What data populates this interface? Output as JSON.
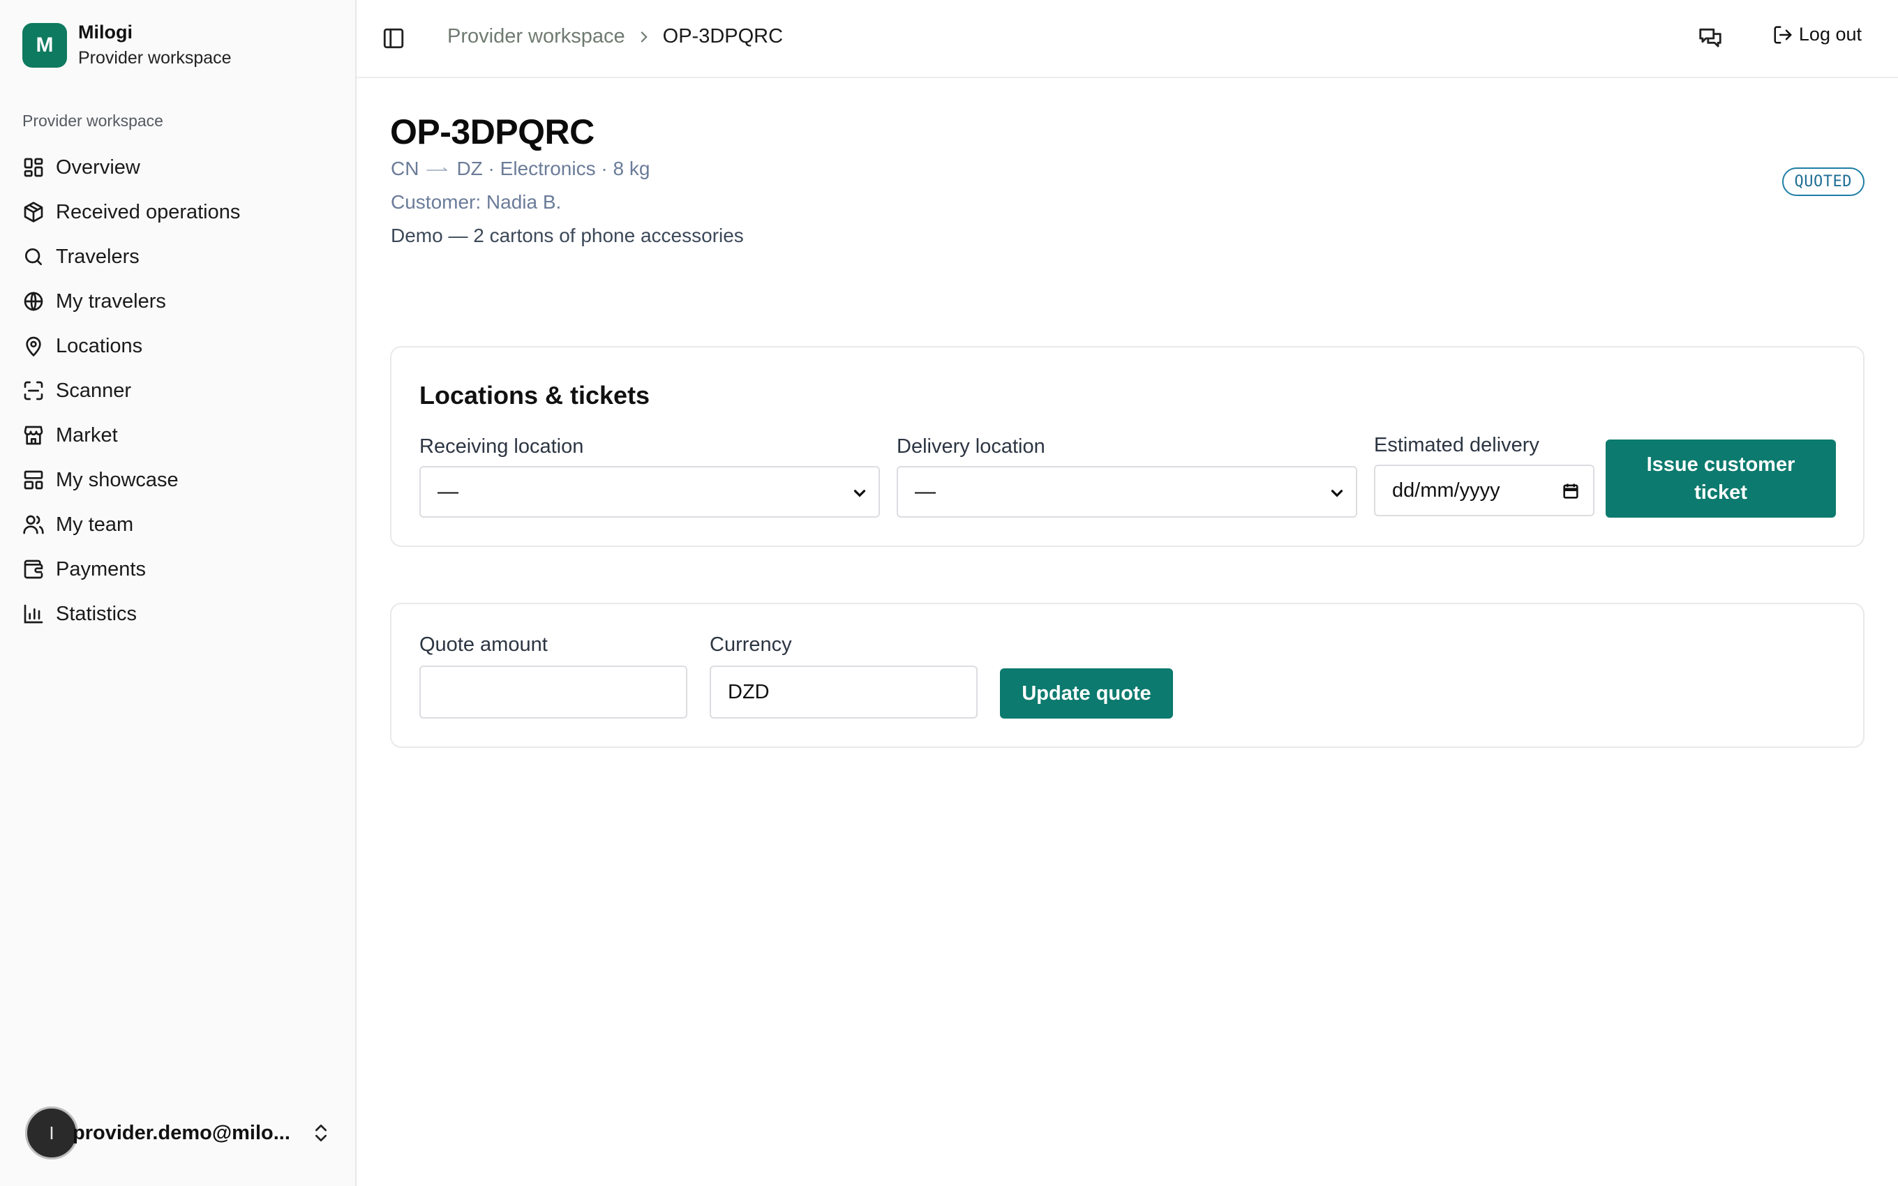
{
  "brand": {
    "logo_letter": "M",
    "name": "Milogi",
    "subtitle": "Provider workspace"
  },
  "sidebar": {
    "group_label": "Provider workspace",
    "items": [
      {
        "label": "Overview",
        "icon": "dashboard-icon"
      },
      {
        "label": "Received operations",
        "icon": "package-icon"
      },
      {
        "label": "Travelers",
        "icon": "search-icon"
      },
      {
        "label": "My travelers",
        "icon": "globe-icon"
      },
      {
        "label": "Locations",
        "icon": "map-pin-icon"
      },
      {
        "label": "Scanner",
        "icon": "scan-icon"
      },
      {
        "label": "Market",
        "icon": "store-icon"
      },
      {
        "label": "My showcase",
        "icon": "layout-icon"
      },
      {
        "label": "My team",
        "icon": "users-icon"
      },
      {
        "label": "Payments",
        "icon": "wallet-icon"
      },
      {
        "label": "Statistics",
        "icon": "bar-chart-icon"
      }
    ]
  },
  "user": {
    "avatar_letter": "I",
    "email": "provider.demo@milo..."
  },
  "topbar": {
    "breadcrumb_parent": "Provider workspace",
    "breadcrumb_current": "OP-3DPQRC",
    "logout_label": "Log out"
  },
  "operation": {
    "id": "OP-3DPQRC",
    "origin": "CN",
    "route_rest": "DZ · Electronics · 8 kg",
    "customer": "Customer: Nadia B.",
    "description": "Demo — 2 cartons of phone accessories",
    "status": "QUOTED"
  },
  "locations_card": {
    "title": "Locations & tickets",
    "receiving_label": "Receiving location",
    "receiving_value": "—",
    "delivery_label": "Delivery location",
    "delivery_value": "—",
    "estimated_label": "Estimated delivery",
    "estimated_placeholder": "dd/mm/yyyy",
    "issue_button": "Issue customer ticket"
  },
  "quote_card": {
    "amount_label": "Quote amount",
    "amount_value": "",
    "currency_label": "Currency",
    "currency_value": "DZD",
    "update_button": "Update quote"
  },
  "colors": {
    "brand": "#0e7a5f",
    "primary_button": "#0c7a6e",
    "status_badge": "#1e7ea6"
  }
}
